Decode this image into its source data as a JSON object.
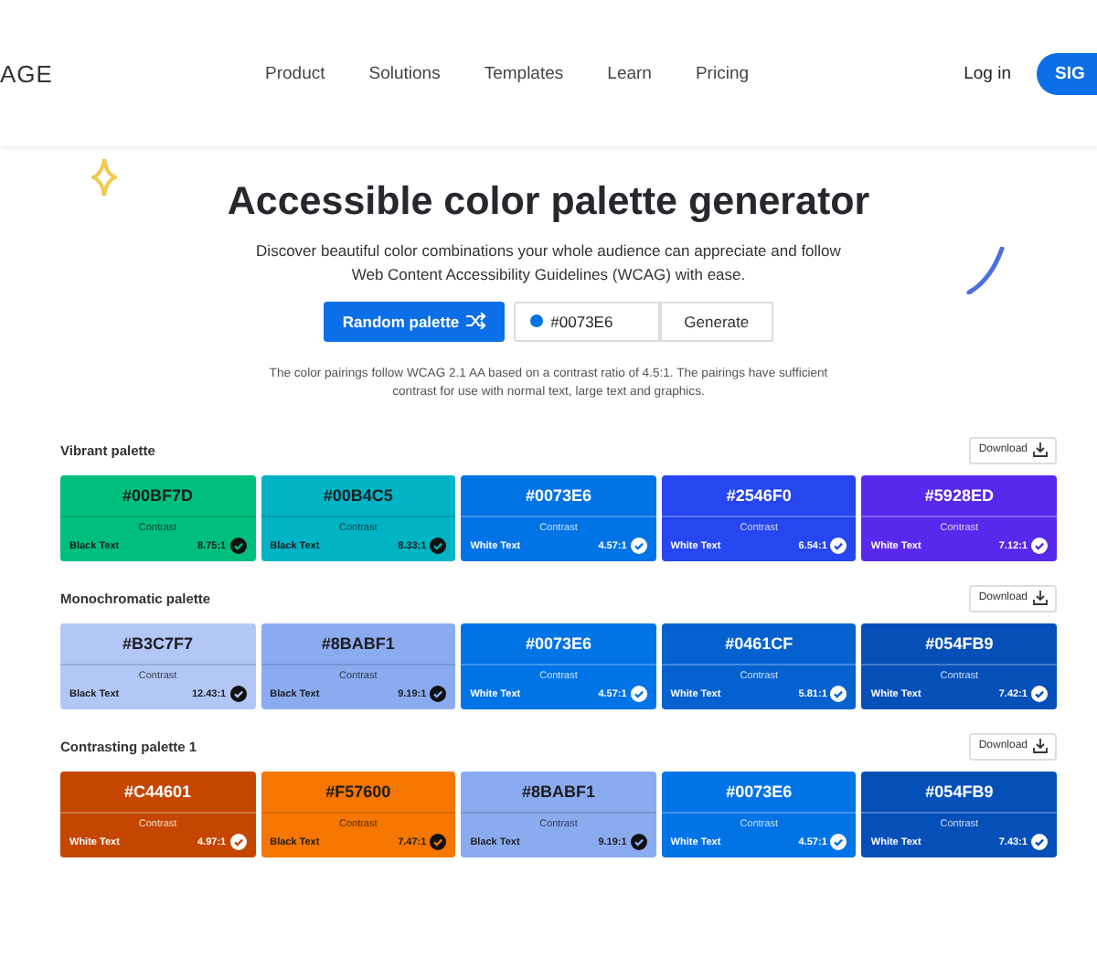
{
  "nav": {
    "logo": "AGE",
    "links": [
      "Product",
      "Solutions",
      "Templates",
      "Learn",
      "Pricing"
    ],
    "login": "Log in",
    "signup": "SIG"
  },
  "hero": {
    "title": "Accessible color palette generator",
    "subtitle": "Discover beautiful color combinations your whole audience can appreciate and follow Web Content Accessibility Guidelines (WCAG) with ease.",
    "random_button": "Random palette",
    "color_field": {
      "value": "#0073E6",
      "color": "#0073e6"
    },
    "generate_button": "Generate",
    "note": "The color pairings follow WCAG 2.1 AA based on a contrast ratio of 4.5:1. The pairings have sufficient contrast for use with normal text, large text and graphics."
  },
  "palettes": [
    {
      "title": "Vibrant palette",
      "download": "Download",
      "swatches": [
        {
          "hex": "#00BF7D",
          "color": "#00bf7d",
          "contrast_label": "Contrast",
          "text": "Black Text",
          "kind": "black",
          "ratio": "8.75:1"
        },
        {
          "hex": "#00B4C5",
          "color": "#00b4c5",
          "contrast_label": "Contrast",
          "text": "Black Text",
          "kind": "black",
          "ratio": "8.33:1"
        },
        {
          "hex": "#0073E6",
          "color": "#0073e6",
          "contrast_label": "Contrast",
          "text": "White Text",
          "kind": "white",
          "ratio": "4.57:1"
        },
        {
          "hex": "#2546F0",
          "color": "#2546f0",
          "contrast_label": "Contrast",
          "text": "White Text",
          "kind": "white",
          "ratio": "6.54:1"
        },
        {
          "hex": "#5928ED",
          "color": "#5928ed",
          "contrast_label": "Contrast",
          "text": "White Text",
          "kind": "white",
          "ratio": "7.12:1"
        }
      ]
    },
    {
      "title": "Monochromatic palette",
      "download": "Download",
      "swatches": [
        {
          "hex": "#B3C7F7",
          "color": "#b3c7f7",
          "contrast_label": "Contrast",
          "text": "Black Text",
          "kind": "black",
          "ratio": "12.43:1"
        },
        {
          "hex": "#8BABF1",
          "color": "#8babf1",
          "contrast_label": "Contrast",
          "text": "Black Text",
          "kind": "black",
          "ratio": "9.19:1"
        },
        {
          "hex": "#0073E6",
          "color": "#0073e6",
          "contrast_label": "Contrast",
          "text": "White Text",
          "kind": "white",
          "ratio": "4.57:1"
        },
        {
          "hex": "#0461CF",
          "color": "#0461cf",
          "contrast_label": "Contrast",
          "text": "White Text",
          "kind": "white",
          "ratio": "5.81:1"
        },
        {
          "hex": "#054FB9",
          "color": "#054fb9",
          "contrast_label": "Contrast",
          "text": "White Text",
          "kind": "white",
          "ratio": "7.42:1"
        }
      ]
    },
    {
      "title": "Contrasting palette 1",
      "download": "Download",
      "swatches": [
        {
          "hex": "#C44601",
          "color": "#c44601",
          "contrast_label": "Contrast",
          "text": "White Text",
          "kind": "white",
          "ratio": "4.97:1"
        },
        {
          "hex": "#F57600",
          "color": "#f57600",
          "contrast_label": "Contrast",
          "text": "Black Text",
          "kind": "black",
          "ratio": "7.47:1"
        },
        {
          "hex": "#8BABF1",
          "color": "#8babf1",
          "contrast_label": "Contrast",
          "text": "Black Text",
          "kind": "black",
          "ratio": "9.19:1"
        },
        {
          "hex": "#0073E6",
          "color": "#0073e6",
          "contrast_label": "Contrast",
          "text": "White Text",
          "kind": "white",
          "ratio": "4.57:1"
        },
        {
          "hex": "#054FB9",
          "color": "#054fb9",
          "contrast_label": "Contrast",
          "text": "White Text",
          "kind": "white",
          "ratio": "7.43:1"
        }
      ]
    }
  ]
}
